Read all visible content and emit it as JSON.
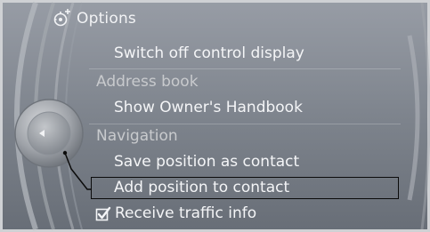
{
  "title": "Options",
  "menu": {
    "items": [
      {
        "type": "item",
        "label": "Switch off control display"
      },
      {
        "type": "header",
        "label": "Address book"
      },
      {
        "type": "item",
        "label": "Show Owner's Handbook"
      },
      {
        "type": "header",
        "label": "Navigation"
      },
      {
        "type": "item",
        "label": "Save position as contact"
      },
      {
        "type": "item",
        "label": "Add position to contact",
        "selected": true
      },
      {
        "type": "checkbox",
        "label": "Receive traffic info",
        "checked": true
      }
    ]
  },
  "icons": {
    "title": "options-icon",
    "controller": "controller-knob-icon",
    "check": "checkmark-icon"
  },
  "colors": {
    "screen_bg_top": "#8d939c",
    "screen_bg_bottom": "#6a7079",
    "text": "#f4f5f7",
    "header_text": "#c8cacd",
    "focus_border": "#0b0b0b"
  }
}
